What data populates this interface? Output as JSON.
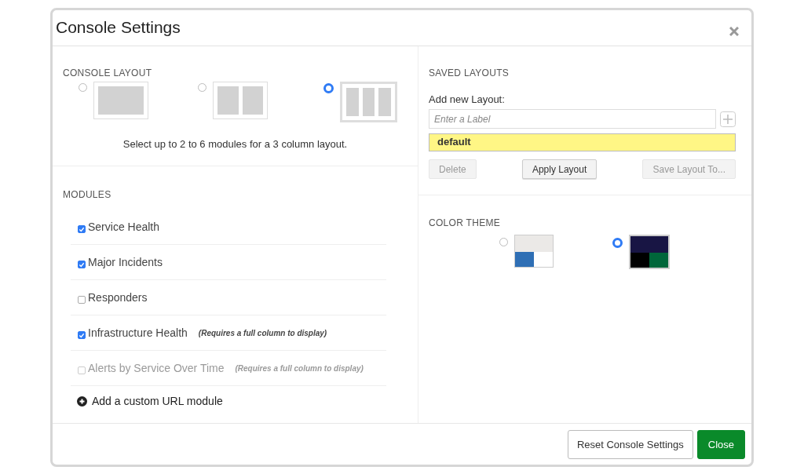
{
  "window": {
    "title": "Console Settings"
  },
  "console_layout": {
    "heading": "CONSOLE LAYOUT",
    "options": [
      {
        "kind": "single",
        "selected": false
      },
      {
        "kind": "double",
        "selected": false
      },
      {
        "kind": "triple",
        "selected": true
      }
    ],
    "hint": "Select up to 2 to 6 modules for a 3 column layout."
  },
  "modules": {
    "heading": "MODULES",
    "items": [
      {
        "label": "Service Health",
        "checked": true,
        "disabled": false
      },
      {
        "label": "Major Incidents",
        "checked": true,
        "disabled": false
      },
      {
        "label": "Responders",
        "checked": false,
        "disabled": false
      },
      {
        "label": "Infrastructure Health",
        "note": "(Requires a full column to display)",
        "checked": true,
        "disabled": false
      },
      {
        "label": "Alerts by Service Over Time",
        "note": "(Requires a full column to display)",
        "checked": false,
        "disabled": true
      }
    ],
    "add_link": "Add a custom URL module"
  },
  "saved_layouts": {
    "heading": "SAVED LAYOUTS",
    "add_label": "Add new Layout:",
    "placeholder": "Enter a Label",
    "layouts": [
      {
        "label": "default",
        "selected": true
      }
    ],
    "buttons": [
      {
        "label": "Delete",
        "disabled": true
      },
      {
        "label": "Apply Layout",
        "disabled": false
      },
      {
        "label": "Save Layout To...",
        "disabled": true
      }
    ]
  },
  "color_theme": {
    "heading": "COLOR THEME",
    "themes": [
      {
        "kind": "light",
        "selected": false
      },
      {
        "kind": "dark",
        "selected": true
      }
    ]
  },
  "footer": {
    "buttons": [
      {
        "label": "Reset Console Settings",
        "kind": "secondary"
      },
      {
        "label": "Close",
        "kind": "primary"
      }
    ]
  }
}
